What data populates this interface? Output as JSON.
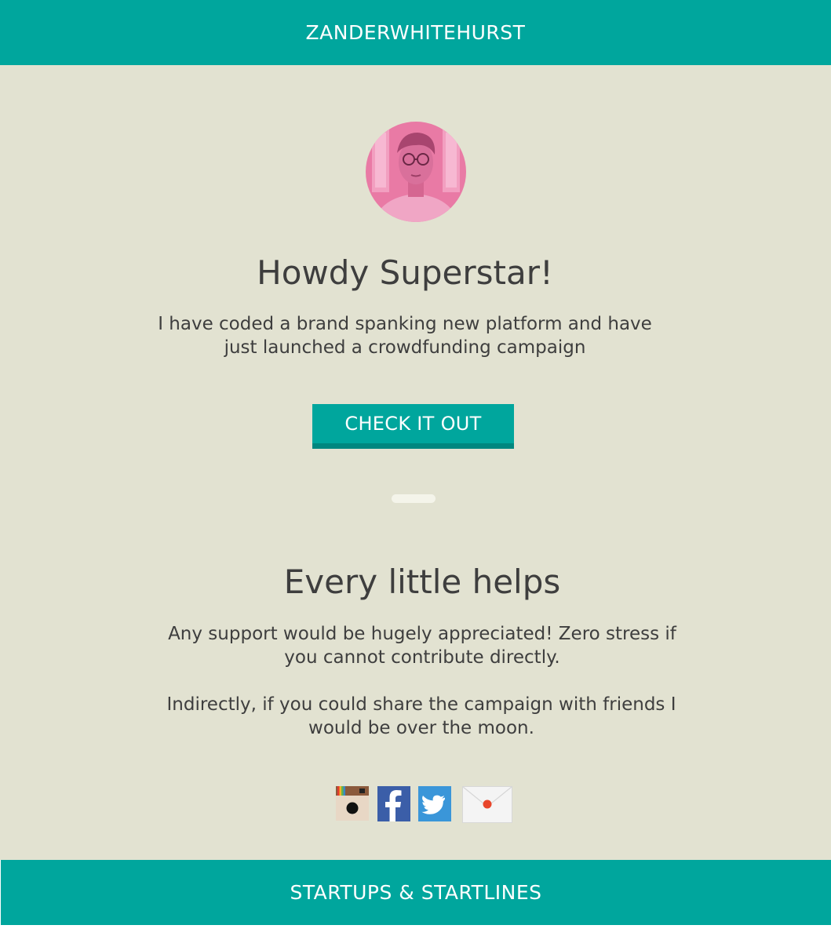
{
  "header": {
    "brand": "ZANDERWHITEHURST"
  },
  "hero": {
    "title": "Howdy Superstar!",
    "text": "I have coded a brand spanking new platform and have just launched a crowdfunding campaign",
    "cta_label": "CHECK IT OUT"
  },
  "support": {
    "title": "Every little helps",
    "text1": "Any support would be hugely appreciated! Zero stress if you cannot contribute directly.",
    "text2": "Indirectly, if you could share the campaign with friends I would be over the moon."
  },
  "social": {
    "icons": [
      "instagram-icon",
      "facebook-icon",
      "twitter-icon",
      "email-icon"
    ]
  },
  "footer": {
    "label": "STARTUPS & STARTLINES"
  },
  "colors": {
    "accent": "#00a69d",
    "accent_dark": "#00877f",
    "background": "#e2e2d1",
    "text": "#3e3e3e"
  }
}
